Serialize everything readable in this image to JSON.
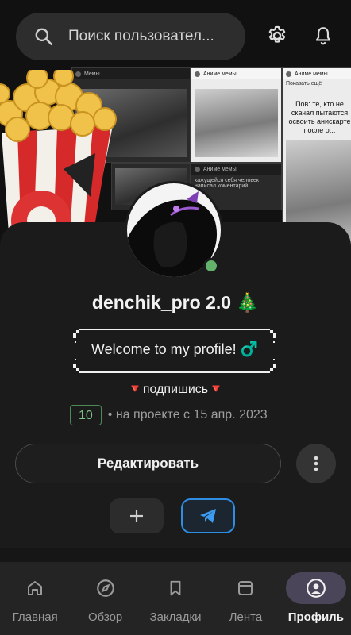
{
  "search": {
    "placeholder": "Поиск пользовател..."
  },
  "banner": {
    "meme_author": "Аниме мемы",
    "meme_label": "Мемы",
    "show_more": "Показать ещё",
    "meme_caption_1": "Пов: те, кто не скачал пытаются освоить анискарте после о...",
    "meme_caption_2": "кажущейся себя человек написал коментарий"
  },
  "profile": {
    "username": "denchik_pro 2.0 🎄",
    "status": "Welcome to my profile! ♂️",
    "tagline": "🔻подпишись🔻",
    "count": "10",
    "since": "• на проекте с 15 апр. 2023",
    "online_color": "#63b36d"
  },
  "actions": {
    "edit_label": "Редактировать"
  },
  "nav": {
    "items": [
      {
        "label": "Главная",
        "icon": "home-icon"
      },
      {
        "label": "Обзор",
        "icon": "compass-icon"
      },
      {
        "label": "Закладки",
        "icon": "bookmark-icon"
      },
      {
        "label": "Лента",
        "icon": "feed-icon"
      },
      {
        "label": "Профиль",
        "icon": "profile-icon",
        "active": true
      }
    ]
  },
  "colors": {
    "accent": "#2f8ee4",
    "active_pill": "#4a4559",
    "background": "#1b1b1b"
  }
}
